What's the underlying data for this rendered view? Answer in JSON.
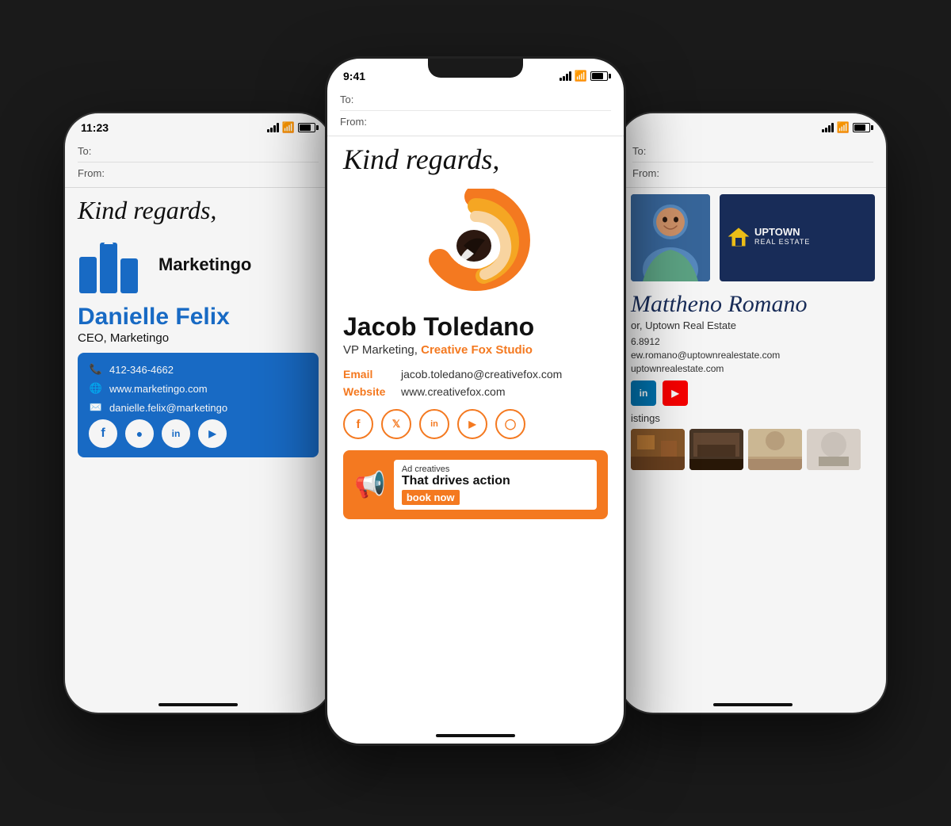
{
  "phones": {
    "left": {
      "status_time": "11:23",
      "email_to": "To:",
      "email_from": "From:",
      "greeting": "Kind regards,",
      "company_name": "Marketingo",
      "person_name": "Danielle Felix",
      "person_title": "CEO, Marketingo",
      "phone": "412-346-4662",
      "website": "www.marketingo.com",
      "email": "danielle.felix@marketingo"
    },
    "center": {
      "status_time": "9:41",
      "email_to": "To:",
      "email_from": "From:",
      "greeting": "Kind regards,",
      "person_name": "Jacob Toledano",
      "person_title_start": "VP Marketing, ",
      "person_company": "Creative Fox Studio",
      "email_label": "Email",
      "email_value": "jacob.toledano@creativefox.com",
      "website_label": "Website",
      "website_value": "www.creativefox.com",
      "ad_small": "Ad creatives",
      "ad_main": "That drives action",
      "ad_cta": "book now"
    },
    "right": {
      "email_to": "To:",
      "email_from": "From:",
      "person_name": "Mattheno Romano",
      "person_title": "or, Uptown Real Estate",
      "phone": "6.8912",
      "email": "ew.romano@uptownrealestate.com",
      "website": "uptownrealestate.com",
      "listings_label": "istings",
      "company_name": "UPTOWN",
      "company_subtitle": "REAL ESTATE"
    }
  }
}
